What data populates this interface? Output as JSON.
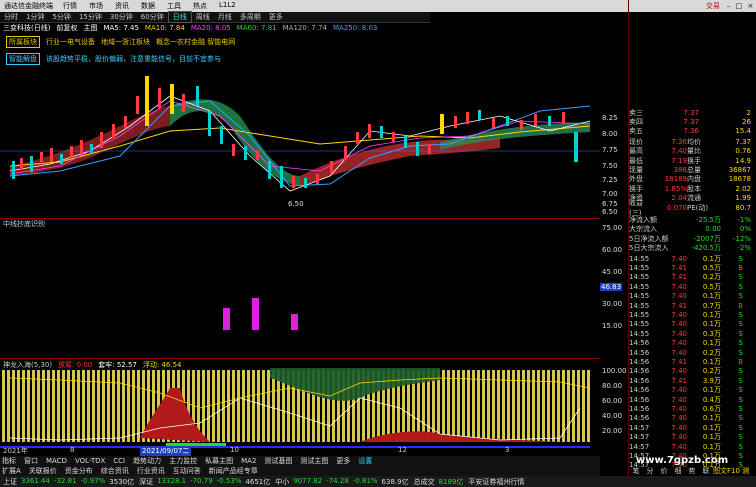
{
  "titlebar": {
    "app": "通达信金融终端",
    "menu": [
      "行情",
      "市场",
      "资讯",
      "数据",
      "工具",
      "热点",
      "L1L2"
    ],
    "deal": "交易"
  },
  "tabs": [
    "分时",
    "1分钟",
    "5分钟",
    "15分钟",
    "30分钟",
    "60分钟",
    "日线",
    "周线",
    "月线",
    "多周期",
    "更多"
  ],
  "active_tab": "日线",
  "stockline": {
    "name": "三变科技(日线)",
    "fq": "前复权",
    "theme": "主图",
    "ma": [
      {
        "label": "MA5: 7.45",
        "color": "#ffffff"
      },
      {
        "label": "MA10: 7.84",
        "color": "#ffd800"
      },
      {
        "label": "MA20: 8.05",
        "color": "#ff40ff"
      },
      {
        "label": "MA60: 7.81",
        "color": "#22dd22"
      },
      {
        "label": "MA120: 7.74",
        "color": "#aaaaaa"
      },
      {
        "label": "MA250: 8.03",
        "color": "#3a9dff"
      }
    ]
  },
  "infoline": {
    "tag": "所属板块",
    "items": [
      "行业一电气设备",
      "地域一浙江板块",
      "概念一农村金融 智能电网"
    ]
  },
  "infoline2": {
    "tag": "智能解盘",
    "text": "该股趋势平稳，股价偏弱，注意重能信号，目前不宜参与"
  },
  "main_axis": [
    "8.25",
    "8.00",
    "7.75",
    "7.50",
    "7.25",
    "7.00",
    "6.75",
    "6.50"
  ],
  "low_label": "6.50",
  "sub1": {
    "label": "中线抄底识别",
    "axis": [
      "75.00",
      "60.00",
      "45.00",
      "30.00",
      "15.00"
    ],
    "value_box": "46.83"
  },
  "sub2": {
    "label": "神龙入海(5,30)",
    "items": [
      {
        "text": "放筹: 0.00",
        "color": "#ff3b3b"
      },
      {
        "text": "套牢: 52.57",
        "color": "#ffffff"
      },
      {
        "text": "浮动: 46.54",
        "color": "#ffd800"
      }
    ],
    "axis": [
      "100.00",
      "80.00",
      "60.00",
      "40.00",
      "20.00"
    ]
  },
  "dates": {
    "d1": "2021年",
    "d2": "8",
    "d3": "2021/09/07二",
    "d4": "10",
    "d5": "12",
    "d6": "3"
  },
  "bottom_tabs": [
    "指标",
    "窗口",
    "MACD",
    "VOL-TDX",
    "CCI",
    "趋势动力",
    "主力监控",
    "私募主图",
    "MA2",
    "测试基图",
    "测试主图",
    "更多",
    "设置"
  ],
  "bottom_tabs2": [
    "扩展A",
    "关联报价",
    "资金分布",
    "综合资讯",
    "行业资讯",
    "互动问答",
    "新闻产品经专章"
  ],
  "right_panel": {
    "asks": [
      [
        "卖三",
        "7.37",
        "2"
      ],
      [
        "卖四",
        "7.37",
        "26"
      ],
      [
        "卖五",
        "7.36",
        "15.4"
      ]
    ],
    "stats": [
      [
        "现价",
        "7.36",
        "均价",
        "7.37"
      ],
      [
        "最高",
        "7.40",
        "量比",
        "0.76"
      ],
      [
        "最低",
        "7.19",
        "换手",
        "14.9"
      ],
      [
        "现量",
        "388",
        "总量",
        "36867"
      ],
      [
        "外盘",
        "18189",
        "内盘",
        "18678"
      ],
      [
        "换手",
        "1.85%",
        "股本",
        "2.02"
      ],
      [
        "净资",
        "2.04",
        "流通",
        "1.99"
      ],
      [
        "收益(三)",
        "0.070",
        "PE(动)",
        "80.7"
      ]
    ],
    "flows": [
      [
        "净流入额",
        "-25.5万",
        "-1%"
      ],
      [
        "大宗流入",
        "0.00",
        "0%"
      ],
      [
        "5日净流入额",
        "-2007万",
        "-12%"
      ],
      [
        "5日大宗流入",
        "-420.5万",
        "-2%"
      ]
    ],
    "ticks": [
      [
        "14:55",
        "7.40",
        "0.1万",
        "S"
      ],
      [
        "14:55",
        "7.41",
        "0.5万",
        "B"
      ],
      [
        "14:55",
        "7.41",
        "0.2万",
        "S"
      ],
      [
        "14:55",
        "7.40",
        "0.5万",
        "S"
      ],
      [
        "14:55",
        "7.40",
        "0.1万",
        "S"
      ],
      [
        "14:55",
        "7.41",
        "0.7万",
        "B"
      ],
      [
        "14:55",
        "7.40",
        "0.1万",
        "S"
      ],
      [
        "14:55",
        "7.40",
        "0.1万",
        "S"
      ],
      [
        "14:55",
        "7.40",
        "0.3万",
        "S"
      ],
      [
        "14:56",
        "7.40",
        "0.1万",
        "S"
      ],
      [
        "14:56",
        "7.40",
        "0.2万",
        "S"
      ],
      [
        "14:56",
        "7.41",
        "0.1万",
        "B"
      ],
      [
        "14:56",
        "7.40",
        "0.2万",
        "S"
      ],
      [
        "14:56",
        "7.41",
        "3.9万",
        "S"
      ],
      [
        "14:56",
        "7.40",
        "0.1万",
        "S"
      ],
      [
        "14:56",
        "7.40",
        "0.4万",
        "S"
      ],
      [
        "14:56",
        "7.40",
        "0.6万",
        "S"
      ],
      [
        "14:56",
        "7.40",
        "0.1万",
        "S"
      ],
      [
        "14:57",
        "7.40",
        "0.1万",
        "S"
      ],
      [
        "14:57",
        "7.40",
        "0.1万",
        "S"
      ],
      [
        "14:57",
        "7.40",
        "0.1万",
        "S"
      ],
      [
        "14:57",
        "7.40",
        "0.1万",
        "S"
      ],
      [
        "14:57",
        "7.40",
        "0.1万",
        "S"
      ]
    ],
    "foot": [
      "笔",
      "分",
      "价",
      "细",
      "势",
      "联"
    ],
    "foot2": "图文F10 测"
  },
  "statusbar": [
    {
      "k": "上证",
      "v": "3361.44",
      "c": "-32.81",
      "p": "-0.97%",
      "a": "3530亿"
    },
    {
      "k": "深证",
      "v": "13328.1",
      "c": "-70.79",
      "p": "-0.53%",
      "a": "4651亿"
    },
    {
      "k": "中小",
      "v": "9077.82",
      "c": "-74.28",
      "p": "-0.81%",
      "a": "638.9亿"
    },
    {
      "k": "总成交",
      "v": "8189亿",
      "c": "",
      "p": "",
      "a": ""
    }
  ],
  "status_tail": "平安证券福州行情",
  "watermark": "www.7gpzb.com"
}
